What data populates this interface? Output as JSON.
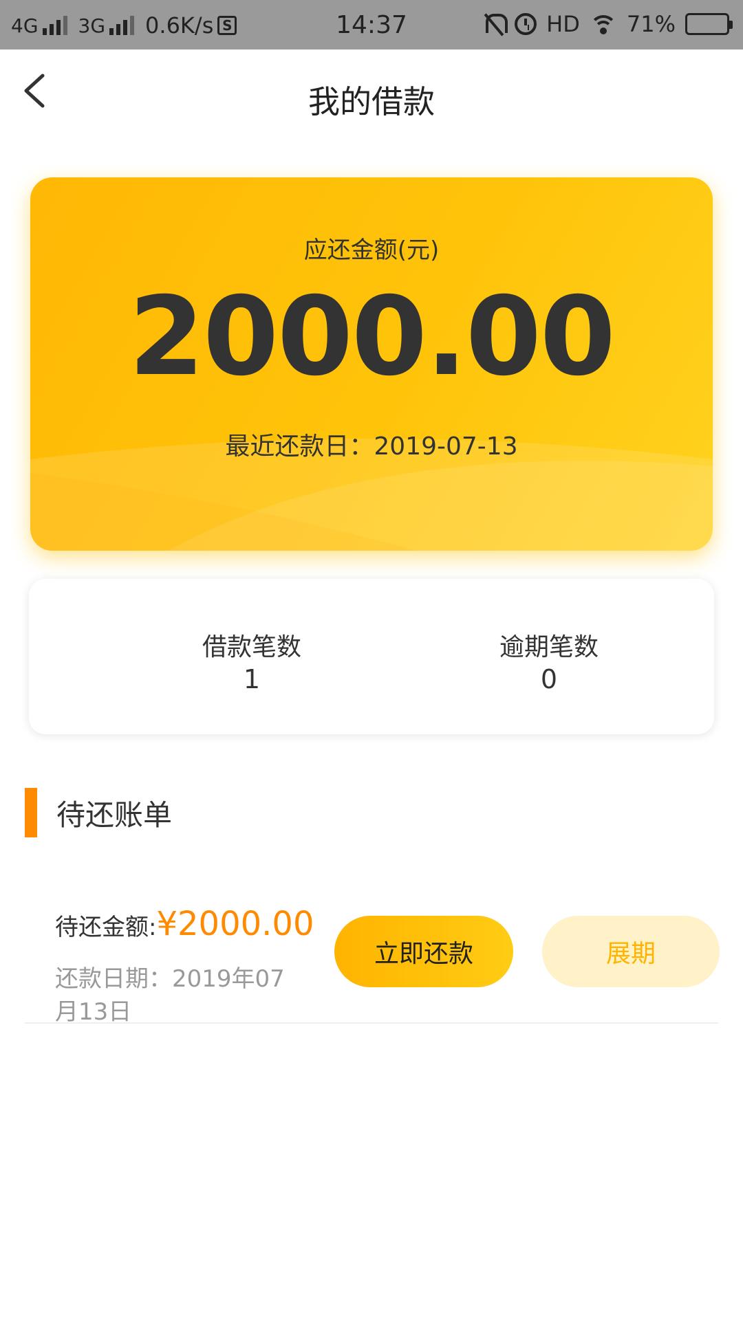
{
  "status_bar": {
    "network1": "4G",
    "network2": "3G",
    "speed": "0.6K/s",
    "s_icon": "S",
    "time": "14:37",
    "hd": "HD",
    "battery": "71%",
    "battery_level": 0.71,
    "icons": [
      "signal-icon",
      "sim-s-icon",
      "bell-off-icon",
      "alarm-icon",
      "wifi-icon",
      "battery-icon"
    ]
  },
  "header": {
    "title": "我的借款",
    "back_icon": "chevron-left-icon"
  },
  "amount_card": {
    "label": "应还金额(元)",
    "amount": "2000.00",
    "due_label": "最近还款日：",
    "due_date": "2019-07-13"
  },
  "stats": {
    "loan_count_label": "借款笔数",
    "loan_count": "1",
    "overdue_count_label": "逾期笔数",
    "overdue_count": "0"
  },
  "section": {
    "title": "待还账单"
  },
  "bill": {
    "amount_label": "待还金额:",
    "amount": "¥2000.00",
    "date_text": "还款日期：2019年07月13日",
    "pay_button": "立即还款",
    "extend_button": "展期"
  },
  "colors": {
    "accent": "#ffc107",
    "accent_orange": "#ff8a00",
    "status_bar": "#9a9a9a",
    "muted_text": "#999999"
  }
}
